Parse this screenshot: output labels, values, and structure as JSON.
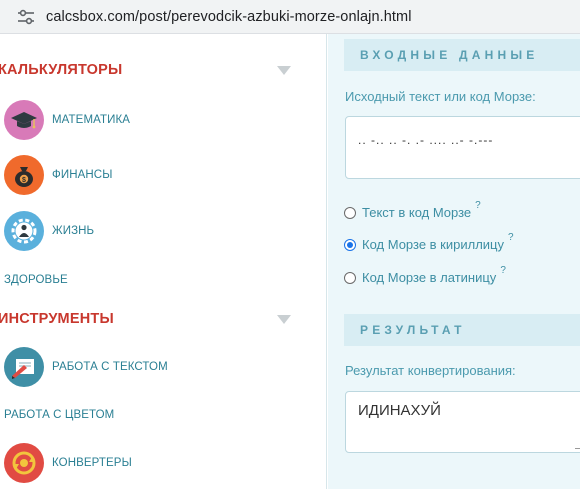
{
  "browser": {
    "url": "calcsbox.com/post/perevodcik-azbuki-morze-onlajn.html"
  },
  "sidebar": {
    "sections": [
      {
        "title": "КАЛЬКУЛЯТОРЫ",
        "items": [
          {
            "label": "МАТЕМАТИКА",
            "icon": "graduation-cap-icon",
            "color": "#d87ab8"
          },
          {
            "label": "ФИНАНСЫ",
            "icon": "money-bag-icon",
            "color": "#f06a2c"
          },
          {
            "label": "ЖИЗНЬ",
            "icon": "person-gear-icon",
            "color": "#5ab0dc"
          },
          {
            "label": "ЗДОРОВЬЕ"
          }
        ]
      },
      {
        "title": "ИНСТРУМЕНТЫ",
        "items": [
          {
            "label": "РАБОТА С ТЕКСТОМ",
            "icon": "text-editor-icon",
            "color": "#3f8fa6"
          },
          {
            "label": "РАБОТА С ЦВЕТОМ"
          },
          {
            "label": "КОНВЕРТЕРЫ",
            "icon": "converter-icon",
            "color": "#e14b43"
          }
        ]
      }
    ]
  },
  "input_block": {
    "heading": "ВХОДНЫЕ ДАННЫЕ",
    "field_label": "Исходный текст или код Морзе:",
    "field_value": ".. -.. .. -. .- .... ..- -.---",
    "options": [
      {
        "label": "Текст в код Морзе",
        "help": "?",
        "checked": false
      },
      {
        "label": "Код Морзе в кириллицу",
        "help": "?",
        "checked": true
      },
      {
        "label": "Код Морзе в латиницу",
        "help": "?",
        "checked": false
      }
    ]
  },
  "result_block": {
    "heading": "РЕЗУЛЬТАТ",
    "field_label": "Результат конвертирования:",
    "field_value": "ИДИНАХУЙ"
  }
}
